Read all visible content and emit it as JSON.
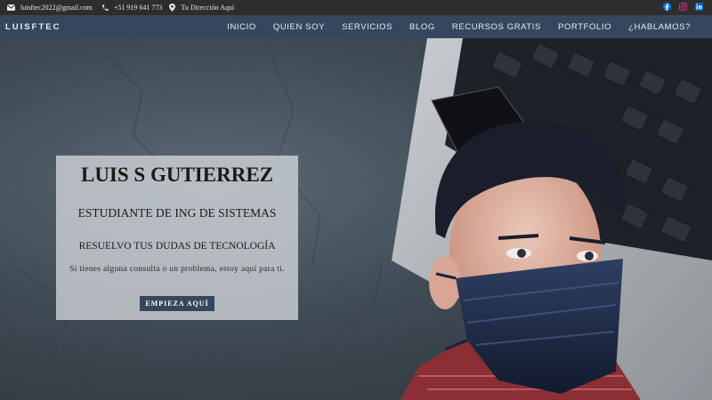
{
  "topbar": {
    "email": "luisftec2022@gmail.com",
    "phone": "+51 919 641 773",
    "address": "Tu Dirección Aquí",
    "social": [
      {
        "name": "facebook-icon",
        "color": "#1877f2"
      },
      {
        "name": "instagram-icon",
        "color": "#c13584"
      },
      {
        "name": "linkedin-icon",
        "color": "#0a66c2"
      }
    ]
  },
  "nav": {
    "brand": "LUISFTEC",
    "items": [
      "INICIO",
      "QUIEN SOY",
      "SERVICIOS",
      "BLOG",
      "RECURSOS GRATIS",
      "PORTFOLIO",
      "¿HABLAMOS?"
    ]
  },
  "hero": {
    "name": "LUIS S GUTIERREZ",
    "role": "ESTUDIANTE DE ING DE SISTEMAS",
    "slogan": "RESUELVO TUS DUDAS DE TECNOLOGÍA",
    "description": "Si tienes alguna consulta o un problema, estoy aquí para ti.",
    "cta": "EMPIEZA AQUÍ"
  },
  "colors": {
    "nav_bg": "#34475d",
    "topbar_bg": "#2d2d2d",
    "button_bg": "#34475d"
  }
}
